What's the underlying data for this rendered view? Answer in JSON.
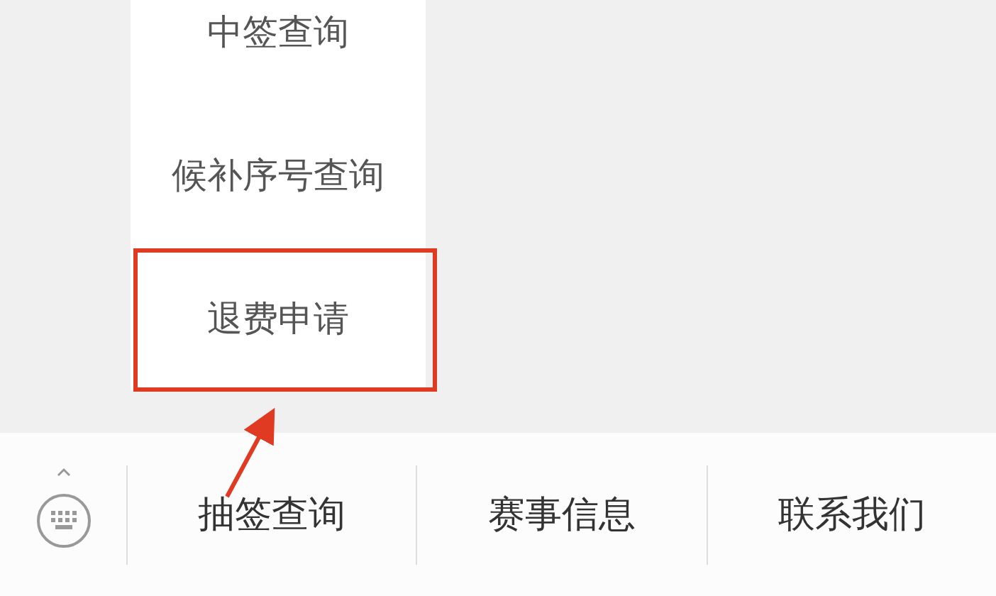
{
  "submenu": {
    "items": [
      {
        "label": "中签查询",
        "highlighted": false
      },
      {
        "label": "候补序号查询",
        "highlighted": false
      },
      {
        "label": "退费申请",
        "highlighted": true
      }
    ]
  },
  "menu_bar": {
    "items": [
      "抽签查询",
      "赛事信息",
      "联系我们"
    ]
  }
}
